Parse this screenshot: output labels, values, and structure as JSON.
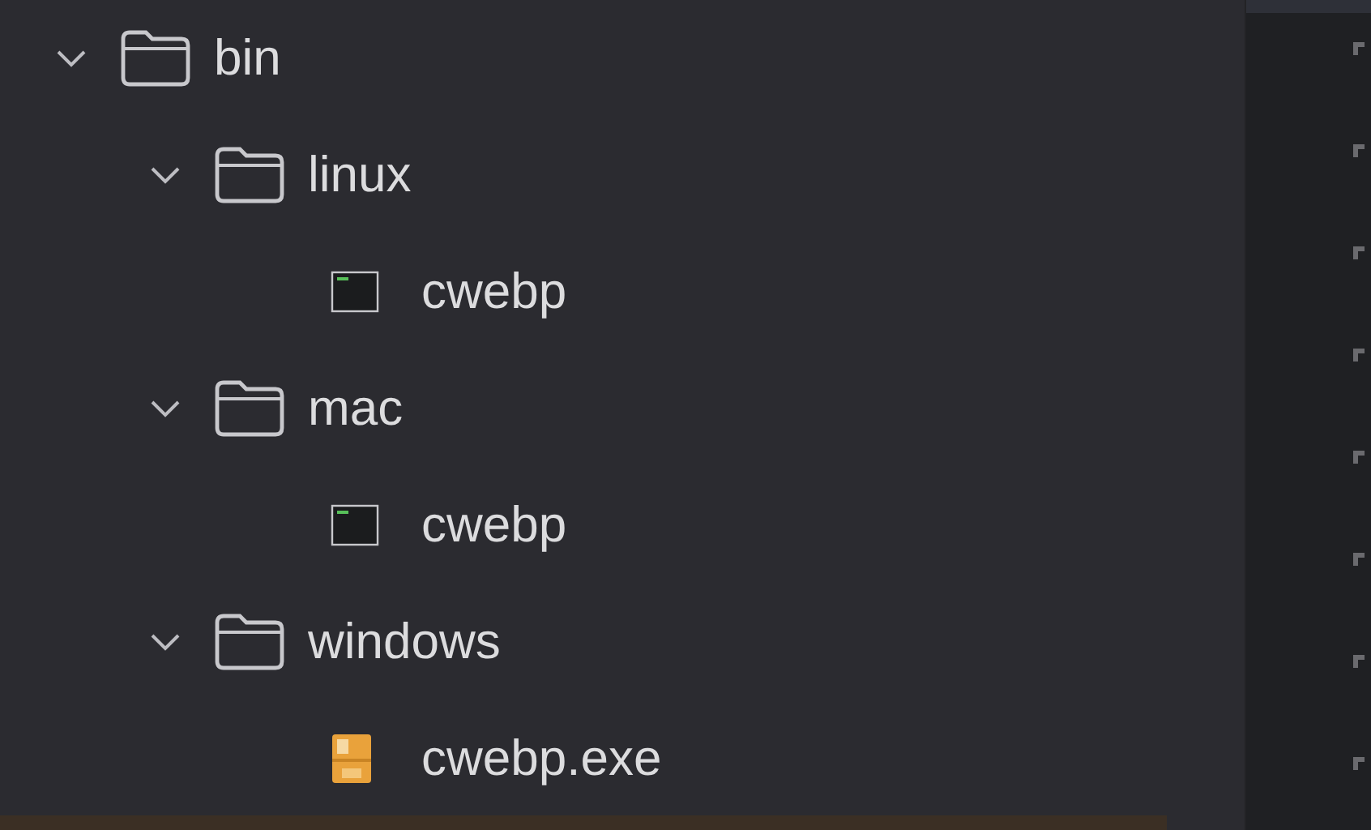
{
  "tree": [
    {
      "kind": "folder",
      "label": "bin",
      "expanded": true,
      "children": [
        {
          "kind": "folder",
          "label": "linux",
          "expanded": true,
          "children": [
            {
              "kind": "terminal",
              "label": "cwebp"
            }
          ]
        },
        {
          "kind": "folder",
          "label": "mac",
          "expanded": true,
          "children": [
            {
              "kind": "terminal",
              "label": "cwebp"
            }
          ]
        },
        {
          "kind": "folder",
          "label": "windows",
          "expanded": true,
          "children": [
            {
              "kind": "exe",
              "label": "cwebp.exe"
            }
          ]
        }
      ]
    }
  ]
}
